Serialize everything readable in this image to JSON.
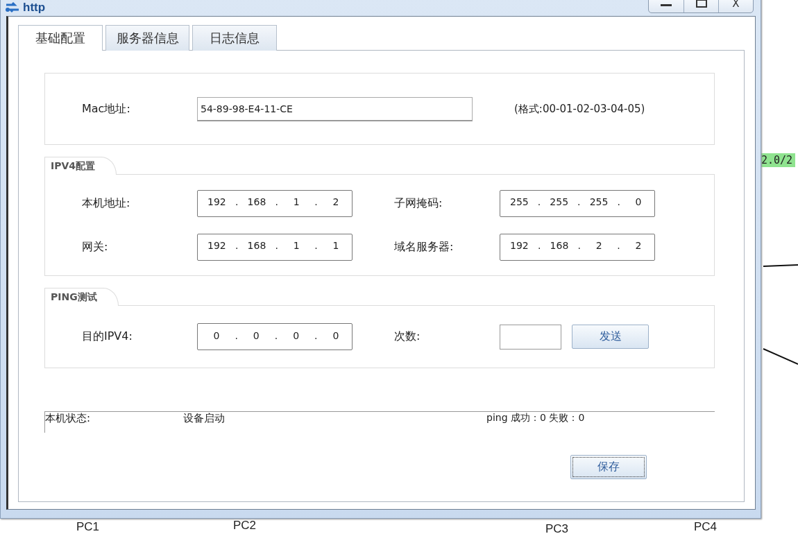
{
  "canvas": {
    "link_label": "2.0/2",
    "devices": [
      {
        "label": "PC1"
      },
      {
        "label": "PC2"
      },
      {
        "label": "PC3"
      },
      {
        "label": "PC4"
      }
    ]
  },
  "window": {
    "title": "http",
    "close": "X"
  },
  "tabs": [
    {
      "label": "基础配置",
      "selected": true
    },
    {
      "label": "服务器信息",
      "selected": false
    },
    {
      "label": "日志信息",
      "selected": false
    }
  ],
  "mac": {
    "label": "Mac地址:",
    "value": "54-89-98-E4-11-CE",
    "hint": "(格式:00-01-02-03-04-05)"
  },
  "ipv4": {
    "title": "IPV4配置",
    "separator": ".",
    "fields": [
      {
        "label": "本机地址:",
        "octets": [
          "192",
          "168",
          "1",
          "2"
        ]
      },
      {
        "label": "子网掩码:",
        "octets": [
          "255",
          "255",
          "255",
          "0"
        ]
      },
      {
        "label": "网关:",
        "octets": [
          "192",
          "168",
          "1",
          "1"
        ]
      },
      {
        "label": "域名服务器:",
        "octets": [
          "192",
          "168",
          "2",
          "2"
        ]
      }
    ]
  },
  "ping": {
    "title": "PING测试",
    "target_label": "目的IPV4:",
    "target_octets": [
      "0",
      "0",
      "0",
      "0"
    ],
    "count_label": "次数:",
    "send_button": "发送"
  },
  "status": {
    "label": "本机状态:",
    "value": "设备启动",
    "result": "ping 成功：0 失败：0"
  },
  "save_button": "保存"
}
